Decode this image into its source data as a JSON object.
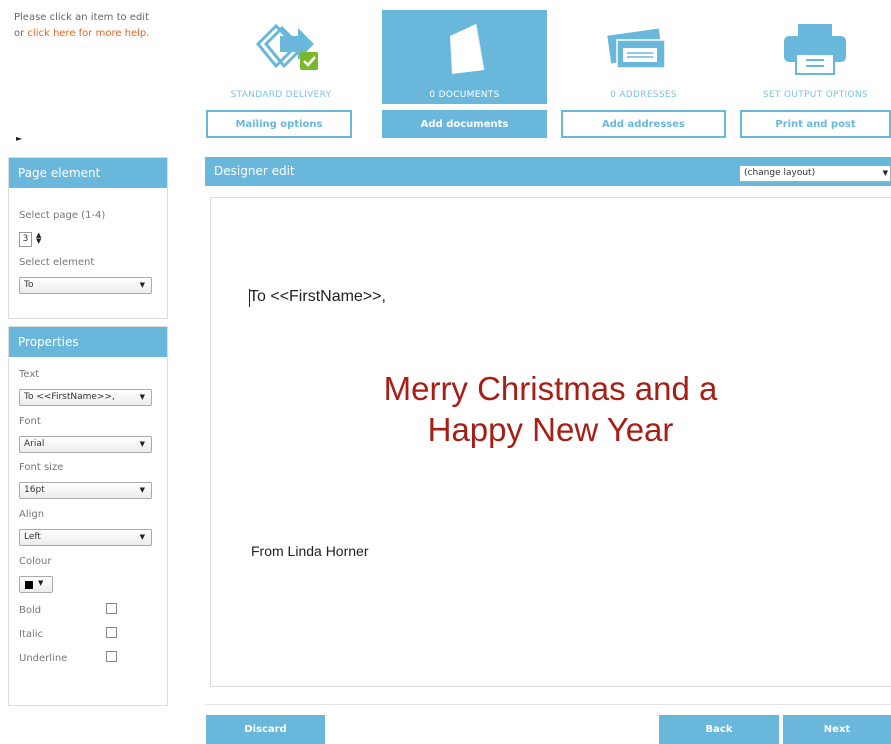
{
  "help": {
    "line1": "Please click an item to edit",
    "or": "or ",
    "link": "click here for more help."
  },
  "steps": [
    {
      "caption": "STANDARD DELIVERY",
      "button": "Mailing options",
      "icon": "delivery-icon"
    },
    {
      "caption": "0 DOCUMENTS",
      "button": "Add documents",
      "icon": "document-icon",
      "active": true
    },
    {
      "caption": "0 ADDRESSES",
      "button": "Add addresses",
      "icon": "envelopes-icon"
    },
    {
      "caption": "SET OUTPUT OPTIONS",
      "button": "Print and post",
      "icon": "printer-icon"
    }
  ],
  "page_element": {
    "title": "Page element",
    "select_page_label": "Select page (1-4)",
    "page_value": "3",
    "select_element_label": "Select element",
    "element_value": "To"
  },
  "properties": {
    "title": "Properties",
    "text_label": "Text",
    "text_value": "To <<FirstName>>,",
    "font_label": "Font",
    "font_value": "Arial",
    "size_label": "Font size",
    "size_value": "16pt",
    "align_label": "Align",
    "align_value": "Left",
    "colour_label": "Colour",
    "colour_value": "#000000",
    "bold_label": "Bold",
    "italic_label": "Italic",
    "underline_label": "Underline"
  },
  "designer": {
    "title": "Designer edit",
    "layout_select": "(change layout)",
    "greeting": "To <<FirstName>>,",
    "headline_line1": "Merry Christmas and a",
    "headline_line2": "Happy New Year",
    "signature": "From Linda Horner"
  },
  "buttons": {
    "discard": "Discard",
    "back": "Back",
    "next": "Next"
  },
  "colors": {
    "accent": "#6ab7dc",
    "link": "#e8621d",
    "headline": "#a61e14"
  }
}
